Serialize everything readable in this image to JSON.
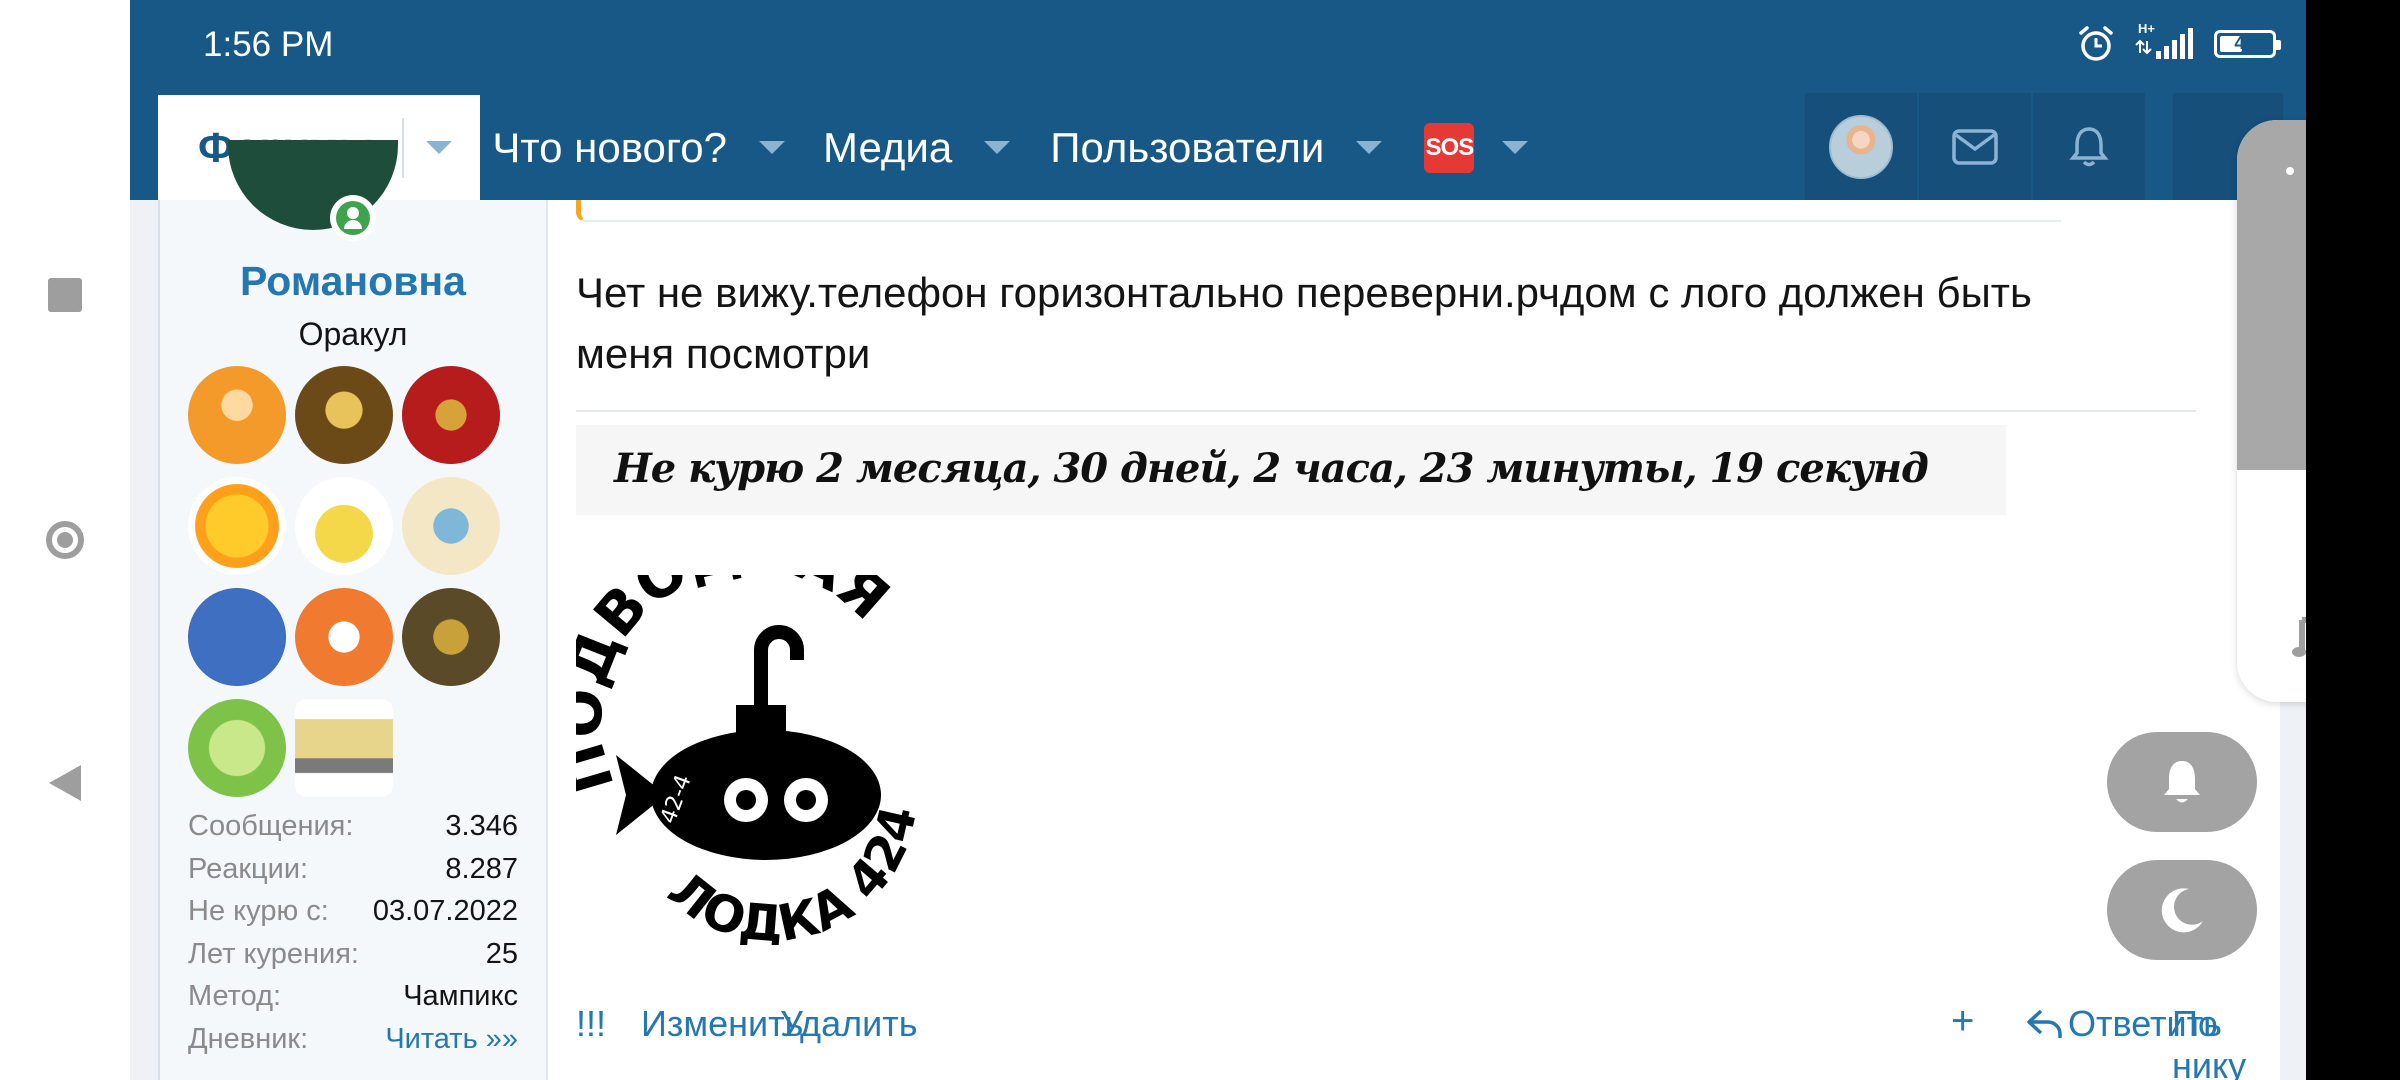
{
  "status": {
    "time": "1:56 PM",
    "battery": "44",
    "network": "H+",
    "battery_level": 0.44
  },
  "nav": {
    "tabs": [
      {
        "label": "Форумы"
      },
      {
        "label": "Что нового?"
      },
      {
        "label": "Медиа"
      },
      {
        "label": "Пользователи"
      },
      {
        "label": "SOS"
      }
    ]
  },
  "user": {
    "name": "Романовна",
    "title": "Оракул",
    "stats": [
      {
        "key": "Сообщения:",
        "value": "3.346"
      },
      {
        "key": "Реакции:",
        "value": "8.287"
      },
      {
        "key": "Не курю с:",
        "value": "03.07.2022"
      },
      {
        "key": "Лет курения:",
        "value": "25"
      },
      {
        "key": "Метод:",
        "value": "Чампикс"
      },
      {
        "key": "Дневник:",
        "value": "Читать »»"
      }
    ]
  },
  "post": {
    "message_line1": "Чет не вижу.телефон горизонтально переверни.рчдом с лого должен быть",
    "message_line2": "меня посмотри",
    "signature": "Не курю  2 месяца, 30 дней, 2 часа, 23 минуты, 19 секунд",
    "logo_top": "ПОДВОДНАЯ",
    "logo_bottom": "ЛОДКА 424",
    "logo_number": "42-4",
    "actions": {
      "bang": "!!!",
      "edit": "Изменить",
      "delete": "Удалить",
      "plus": "+",
      "reply": "Ответить",
      "by_nick": "По нику"
    }
  },
  "colors": {
    "header": "#185886",
    "link": "#2577b1",
    "selected_tab_text": "#185886"
  }
}
